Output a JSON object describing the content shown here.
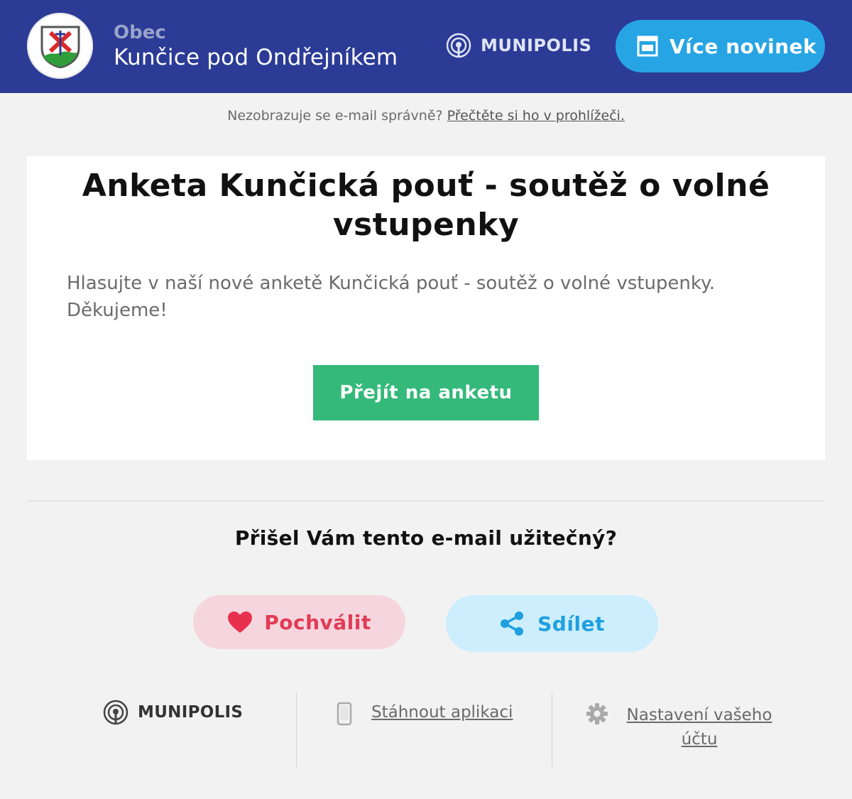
{
  "header": {
    "org_label": "Obec",
    "org_name": "Kunčice pod Ondřejníkem",
    "brand": "MUNIPOLIS",
    "more_news_label": "Více novinek",
    "bg_color": "#2b3b96",
    "button_color": "#27a4e4"
  },
  "notice": {
    "text": "Nezobrazuje se e-mail správně?",
    "link": "Přečtěte si ho v prohlížeči."
  },
  "article": {
    "title": "Anketa Kunčická pouť - soutěž o volné vstupenky",
    "body": "Hlasujte v naší nové anketě Kunčická pouť - soutěž o volné vstupenky. Děkujeme!",
    "button_label": "Přejít na anketu",
    "button_color": "#34b97a"
  },
  "feedback": {
    "question": "Přišel Vám tento e-mail užitečný?",
    "praise_label": "Pochválit",
    "share_label": "Sdílet",
    "praise_color": "#e23b55",
    "share_color": "#1e9fe0"
  },
  "footer": {
    "brand": "MUNIPOLIS",
    "download_label": "Stáhnout aplikaci",
    "settings_label": "Nastavení vašeho účtu"
  },
  "icons": {
    "crest": "coat-of-arms-icon",
    "brand": "signal-icon",
    "news": "newspaper-icon",
    "praise": "heart-icon",
    "share": "share-icon",
    "download": "phone-icon",
    "settings": "gear-icon"
  }
}
